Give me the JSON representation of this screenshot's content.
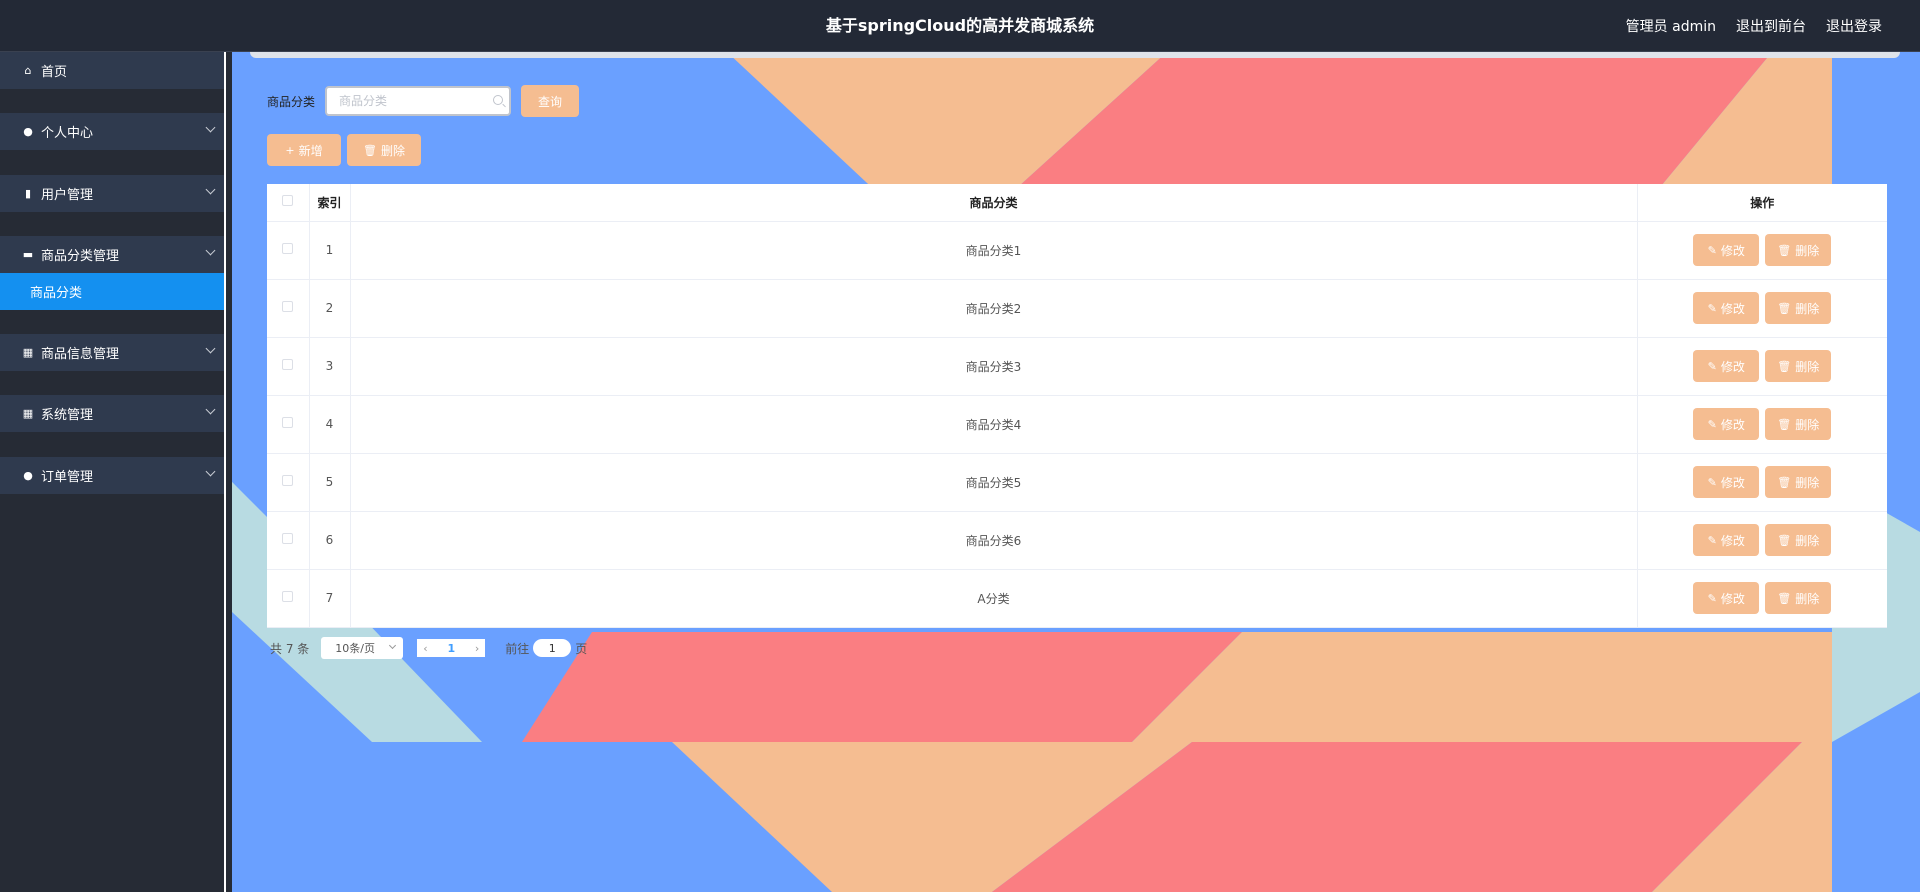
{
  "header": {
    "title": "基于springCloud的高并发商城系统",
    "admin_label": "管理员 admin",
    "front_label": "退出到前台",
    "logout_label": "退出登录"
  },
  "sidebar": {
    "items": [
      {
        "label": "首页",
        "icon": "home-icon"
      },
      {
        "label": "个人中心",
        "icon": "user-icon"
      },
      {
        "label": "用户管理",
        "icon": "clipboard-icon"
      },
      {
        "label": "商品分类管理",
        "icon": "monitor-icon"
      },
      {
        "label": "商品信息管理",
        "icon": "grid-icon"
      },
      {
        "label": "系统管理",
        "icon": "grid-icon"
      },
      {
        "label": "订单管理",
        "icon": "location-icon"
      }
    ],
    "active_sub": "商品分类"
  },
  "search": {
    "label": "商品分类",
    "placeholder": "商品分类",
    "query_button": "查询"
  },
  "actions": {
    "add_label": "新增",
    "delete_label": "删除"
  },
  "table": {
    "headers": [
      "索引",
      "商品分类",
      "操作"
    ],
    "rows": [
      {
        "index": "1",
        "category": "商品分类1"
      },
      {
        "index": "2",
        "category": "商品分类2"
      },
      {
        "index": "3",
        "category": "商品分类3"
      },
      {
        "index": "4",
        "category": "商品分类4"
      },
      {
        "index": "5",
        "category": "商品分类5"
      },
      {
        "index": "6",
        "category": "商品分类6"
      },
      {
        "index": "7",
        "category": "A分类"
      }
    ],
    "edit_label": "修改",
    "delete_label": "删除"
  },
  "pagination": {
    "total": "共 7 条",
    "page_size": "10条/页",
    "current_page": "1",
    "goto_prefix": "前往",
    "goto_value": "1",
    "goto_suffix": "页"
  },
  "colors": {
    "accent_orange": "#f5bd91",
    "sidebar_active": "#1490f0",
    "bg_blue": "#6aa0ff",
    "bg_red": "#fa7e82",
    "bg_peach": "#f5bd91",
    "bg_light": "#b8dbe2"
  }
}
